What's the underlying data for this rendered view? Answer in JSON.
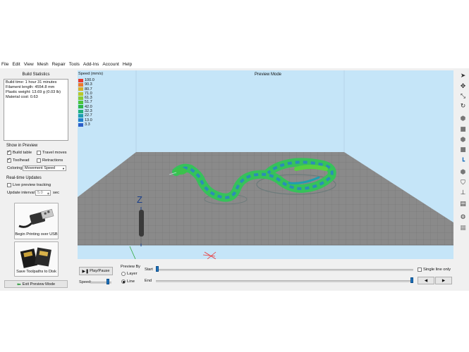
{
  "menu": [
    "File",
    "Edit",
    "View",
    "Mesh",
    "Repair",
    "Tools",
    "Add-Ins",
    "Account",
    "Help"
  ],
  "build_stats": {
    "title": "Build Statistics",
    "lines": [
      "Build time: 1 hour 31 minutes",
      "Filament length: 4554.8 mm",
      "Plastic weight: 13.69 g (0.03 lb)",
      "Material cost: 0.63"
    ]
  },
  "show_in_preview": {
    "title": "Show in Preview",
    "build_table": {
      "label": "Build table",
      "checked": true
    },
    "travel_moves": {
      "label": "Travel moves",
      "checked": false
    },
    "toolhead": {
      "label": "Toolhead",
      "checked": true
    },
    "retractions": {
      "label": "Retractions",
      "checked": false
    },
    "coloring_label": "Coloring",
    "coloring_value": "Movement Speed"
  },
  "realtime": {
    "title": "Real-time Updates",
    "live_tracking": {
      "label": "Live preview tracking",
      "checked": false
    },
    "interval_label": "Update interval",
    "interval_value": "5.0",
    "interval_unit": "sec"
  },
  "buttons": {
    "usb": "Begin Printing over USB",
    "sd": "Save Toolpaths to Disk",
    "exit": "Exit Preview Mode"
  },
  "viewport": {
    "title": "Preview Mode",
    "legend_title": "Speed (mm/s)",
    "legend": [
      {
        "value": "100.0",
        "color": "#e8382e"
      },
      {
        "value": "90.3",
        "color": "#ec7a2d"
      },
      {
        "value": "80.7",
        "color": "#d8b027"
      },
      {
        "value": "71.0",
        "color": "#b8c82a"
      },
      {
        "value": "61.3",
        "color": "#88cc33"
      },
      {
        "value": "51.7",
        "color": "#4cc43a"
      },
      {
        "value": "42.0",
        "color": "#2db84a"
      },
      {
        "value": "32.3",
        "color": "#22b07a"
      },
      {
        "value": "22.7",
        "color": "#1e9eb0"
      },
      {
        "value": "13.0",
        "color": "#2080cc"
      },
      {
        "value": "3.3",
        "color": "#2c5fc8"
      }
    ],
    "axis_label": "Z",
    "bg_color": "#c5e5f8",
    "bed_color": "#8a8a8a"
  },
  "playback": {
    "play_label": "Play/Pause",
    "speed_label": "Speed:",
    "preview_by_label": "Preview By",
    "layer_label": "Layer",
    "line_label": "Line",
    "preview_by_selected": "Line",
    "start_label": "Start",
    "end_label": "End",
    "single_line_label": "Single line only",
    "single_line_checked": false,
    "start_fraction": 0.0,
    "end_fraction": 1.0
  }
}
